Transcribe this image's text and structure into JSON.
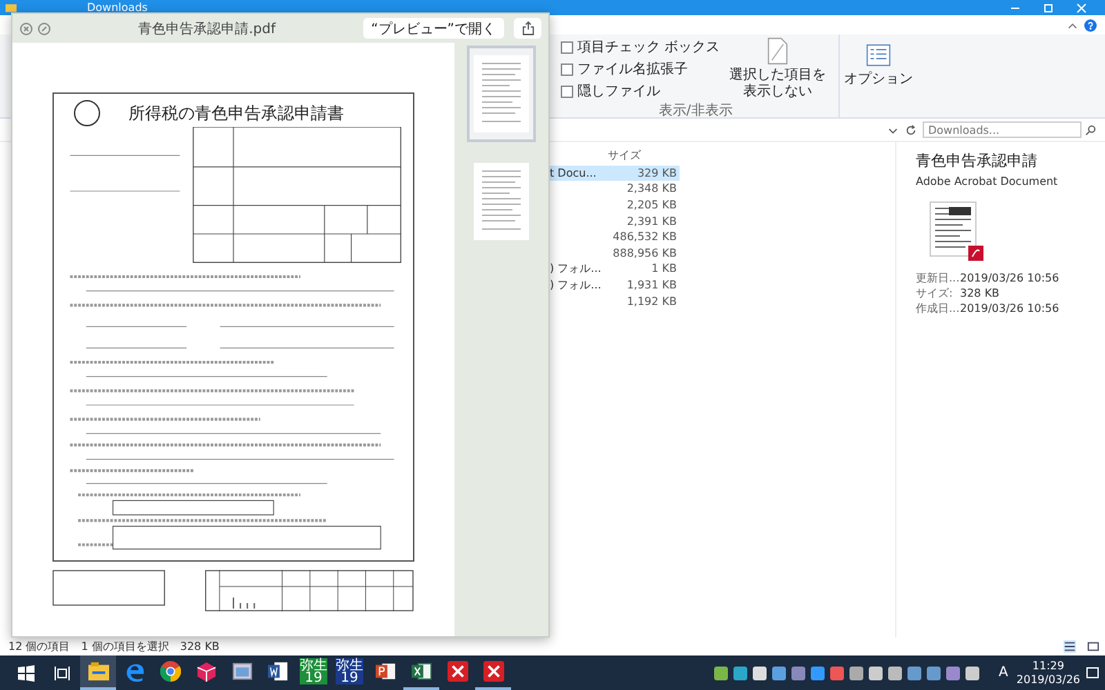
{
  "explorer": {
    "title": "Downloads",
    "ribbon": {
      "checkboxes": [
        {
          "label": "項目チェック ボックス",
          "checked": false
        },
        {
          "label": "ファイル名拡張子",
          "checked": false
        },
        {
          "label": "隠しファイル",
          "checked": false
        }
      ],
      "hide_button": {
        "line_1": "選択した項目を",
        "line_2": "表示しない"
      },
      "options_button": "オプション",
      "group_label": "表示/非表示"
    },
    "search": {
      "placeholder": "Downloads..."
    },
    "file_list": {
      "size_heading": "サイズ",
      "rows": [
        {
          "column_1": "t Docu...",
          "size": "329 KB",
          "selected": true
        },
        {
          "column_1": "",
          "size": "2,348 KB",
          "selected": false
        },
        {
          "column_1": "",
          "size": "2,205 KB",
          "selected": false
        },
        {
          "column_1": "",
          "size": "2,391 KB",
          "selected": false
        },
        {
          "column_1": "",
          "size": "486,532 KB",
          "selected": false
        },
        {
          "column_1": "",
          "size": "888,956 KB",
          "selected": false
        },
        {
          "column_1": ") フォル...",
          "size": "1 KB",
          "selected": false
        },
        {
          "column_1": ") フォル...",
          "size": "1,931 KB",
          "selected": false
        },
        {
          "column_1": "",
          "size": "1,192 KB",
          "selected": false
        }
      ]
    },
    "details": {
      "title": "青色申告承認申請",
      "type": "Adobe Acrobat Document",
      "meta": [
        {
          "label": "更新日...",
          "value": "2019/03/26 10:56"
        },
        {
          "label": "サイズ:",
          "value": "328 KB"
        },
        {
          "label": "作成日...",
          "value": "2019/03/26 10:56"
        }
      ]
    },
    "status_bar": {
      "item_count": "12 個の項目",
      "selection": "1 個の項目を選択",
      "selection_size": "328 KB"
    }
  },
  "quick_look": {
    "title": "青色申告承認申請.pdf",
    "open_button": "“プレビュー”で開く",
    "document": {
      "title": "所得税の青色申告承認申請書"
    },
    "thumbnails": [
      {
        "selected": true
      },
      {
        "selected": false
      }
    ]
  },
  "taskbar": {
    "apps": [
      {
        "kind": "explorer",
        "active": true,
        "running": true
      },
      {
        "kind": "edge",
        "active": false,
        "running": false
      },
      {
        "kind": "chrome",
        "active": false,
        "running": false
      },
      {
        "kind": "cube",
        "active": false,
        "running": false
      },
      {
        "kind": "window",
        "active": false,
        "running": false
      },
      {
        "kind": "word",
        "active": false,
        "running": false
      },
      {
        "kind": "yayoi",
        "color": "#1e8f3a",
        "line_1": "弥生",
        "line_2": "19",
        "active": false,
        "running": false
      },
      {
        "kind": "yayoi",
        "color": "#1a3a8c",
        "line_1": "弥生",
        "line_2": "19",
        "active": false,
        "running": false
      },
      {
        "kind": "powerpoint",
        "active": false,
        "running": false
      },
      {
        "kind": "excel",
        "active": false,
        "running": true
      },
      {
        "kind": "crossx",
        "active": false,
        "running": false
      },
      {
        "kind": "crossx",
        "active": false,
        "running": true
      }
    ],
    "ime": "A",
    "clock": {
      "time": "11:29",
      "date": "2019/03/26"
    }
  }
}
